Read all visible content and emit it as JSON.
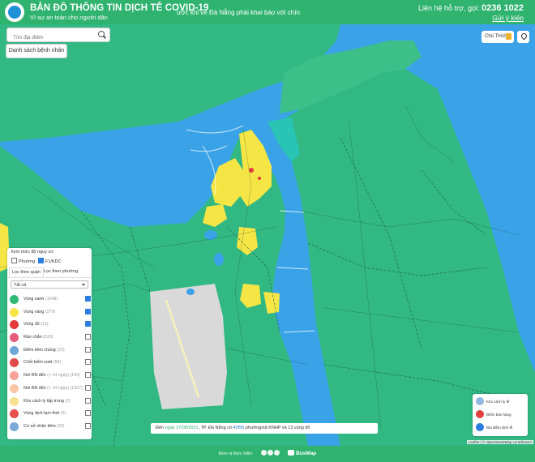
{
  "header": {
    "title": "BẢN ĐỒ THÔNG TIN DỊCH TỄ COVID-19",
    "subtitle": "Vì sự an toàn cho người dân",
    "marquee": "ước khi về Đà Nẵng phải khai báo với chín",
    "support_label": "Liên hệ hỗ trợ, gọi:",
    "support_phone": "0236 1022",
    "feedback_link": "Gửi ý kiến"
  },
  "search": {
    "placeholder": "Tìm địa điểm"
  },
  "patients_button": "Danh sách bệnh nhân",
  "legend_button": "Chú Thích",
  "filter_panel": {
    "level_title": "Xem mức độ nguy cơ",
    "level_options": [
      {
        "label": "Phường",
        "checked": false
      },
      {
        "label": "F1/KDC",
        "checked": true
      }
    ],
    "tabs": [
      "Lọc theo quận",
      "Lọc theo phường"
    ],
    "active_tab": 0,
    "select_value": "Tất cả",
    "layers": [
      {
        "label": "Vùng xanh",
        "count": "(1048)",
        "color": "#31b876",
        "checked": true
      },
      {
        "label": "Vùng vàng",
        "count": "(279)",
        "color": "#f5e645",
        "checked": true
      },
      {
        "label": "Vùng đỏ",
        "count": "(13)",
        "color": "#e33a3a",
        "checked": true
      },
      {
        "label": "Rào chắn",
        "count": "(633)",
        "color": "#e85a7a",
        "checked": false
      },
      {
        "label": "Điểm tiêm chủng",
        "count": "(22)",
        "color": "#6da7d8",
        "checked": false
      },
      {
        "label": "Chốt kiểm soát",
        "count": "(68)",
        "color": "#e24a4a",
        "checked": false
      },
      {
        "label": "Nơi BN đến",
        "count": "(< 14 ngày) (194)",
        "color": "#f7a19a",
        "checked": false
      },
      {
        "label": "Nơi BN đến",
        "count": "(> 14 ngày) (1207)",
        "color": "#f9c6a8",
        "checked": false
      },
      {
        "label": "Khu cách ly tập trung",
        "count": "(2)",
        "color": "#f5e190",
        "checked": false
      },
      {
        "label": "Vùng dịch tạm thời",
        "count": "(6)",
        "color": "#e85050",
        "checked": false
      },
      {
        "label": "Cơ sở nhận tiêm",
        "count": "(25)",
        "color": "#7aa9d6",
        "checked": false
      }
    ]
  },
  "status_bar": {
    "prefix": "Đến",
    "date": "ngày 27/08/2021",
    "mid": ", TP. Đà Nẵng có",
    "ratio": "40/56",
    "suffix": "phường/xã KNHP và 13 vùng đỏ"
  },
  "key_box": {
    "items": [
      {
        "label": "Khu cách ly tế",
        "color": "#8fb9e0"
      },
      {
        "label": "Điểm bán hàng",
        "color": "#e04040"
      },
      {
        "label": "Địa điểm dịch tễ",
        "color": "#2b7de0"
      }
    ]
  },
  "attribution": "Leaflet | © OpenStreetMap contributors",
  "footer": {
    "text": "Đơn vị thực hiện:",
    "brand": "BusMap"
  }
}
